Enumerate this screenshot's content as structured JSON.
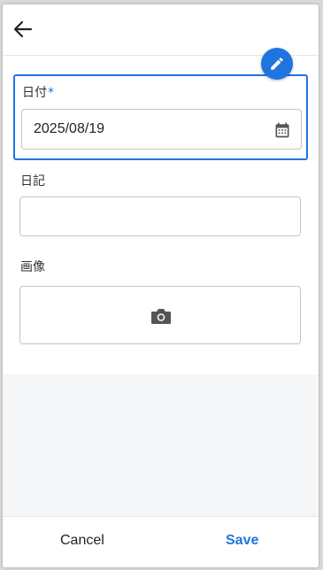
{
  "form": {
    "date_label": "日付",
    "date_required_mark": "*",
    "date_value": "2025/08/19",
    "diary_label": "日記",
    "diary_value": "",
    "image_label": "画像"
  },
  "footer": {
    "cancel_label": "Cancel",
    "save_label": "Save"
  },
  "icons": {
    "back": "arrow-left-icon",
    "edit": "pencil-icon",
    "calendar": "calendar-icon",
    "camera": "camera-icon"
  },
  "colors": {
    "accent": "#1f75e0",
    "border": "#c4c4c4",
    "text": "#222222"
  }
}
